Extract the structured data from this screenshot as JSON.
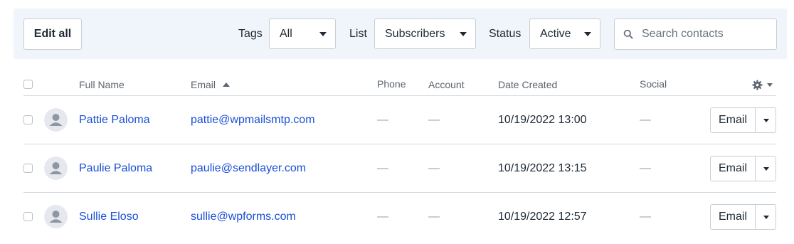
{
  "toolbar": {
    "edit_all_label": "Edit all",
    "filters": [
      {
        "label": "Tags",
        "value": "All"
      },
      {
        "label": "List",
        "value": "Subscribers"
      },
      {
        "label": "Status",
        "value": "Active"
      }
    ],
    "search": {
      "placeholder": "Search contacts",
      "value": "",
      "icon": "search-icon"
    }
  },
  "table": {
    "columns": {
      "full_name": "Full Name",
      "email": "Email",
      "phone": "Phone",
      "account": "Account",
      "date_created": "Date Created",
      "social": "Social"
    },
    "sort": {
      "column": "email",
      "direction": "ascending"
    },
    "settings_icon": "gear-icon",
    "rows": [
      {
        "name": "Pattie Paloma",
        "email": "pattie@wpmailsmtp.com",
        "phone": "—",
        "account": "—",
        "date_created": "10/19/2022 13:00",
        "social": "—",
        "action": "Email"
      },
      {
        "name": "Paulie Paloma",
        "email": "paulie@sendlayer.com",
        "phone": "—",
        "account": "—",
        "date_created": "10/19/2022 13:15",
        "social": "—",
        "action": "Email"
      },
      {
        "name": "Sullie Eloso",
        "email": "sullie@wpforms.com",
        "phone": "—",
        "account": "—",
        "date_created": "10/19/2022 12:57",
        "social": "—",
        "action": "Email"
      }
    ]
  },
  "colors": {
    "link": "#1a4fd6",
    "toolbar_bg": "#f0f4fb",
    "border": "#c8ced6"
  }
}
